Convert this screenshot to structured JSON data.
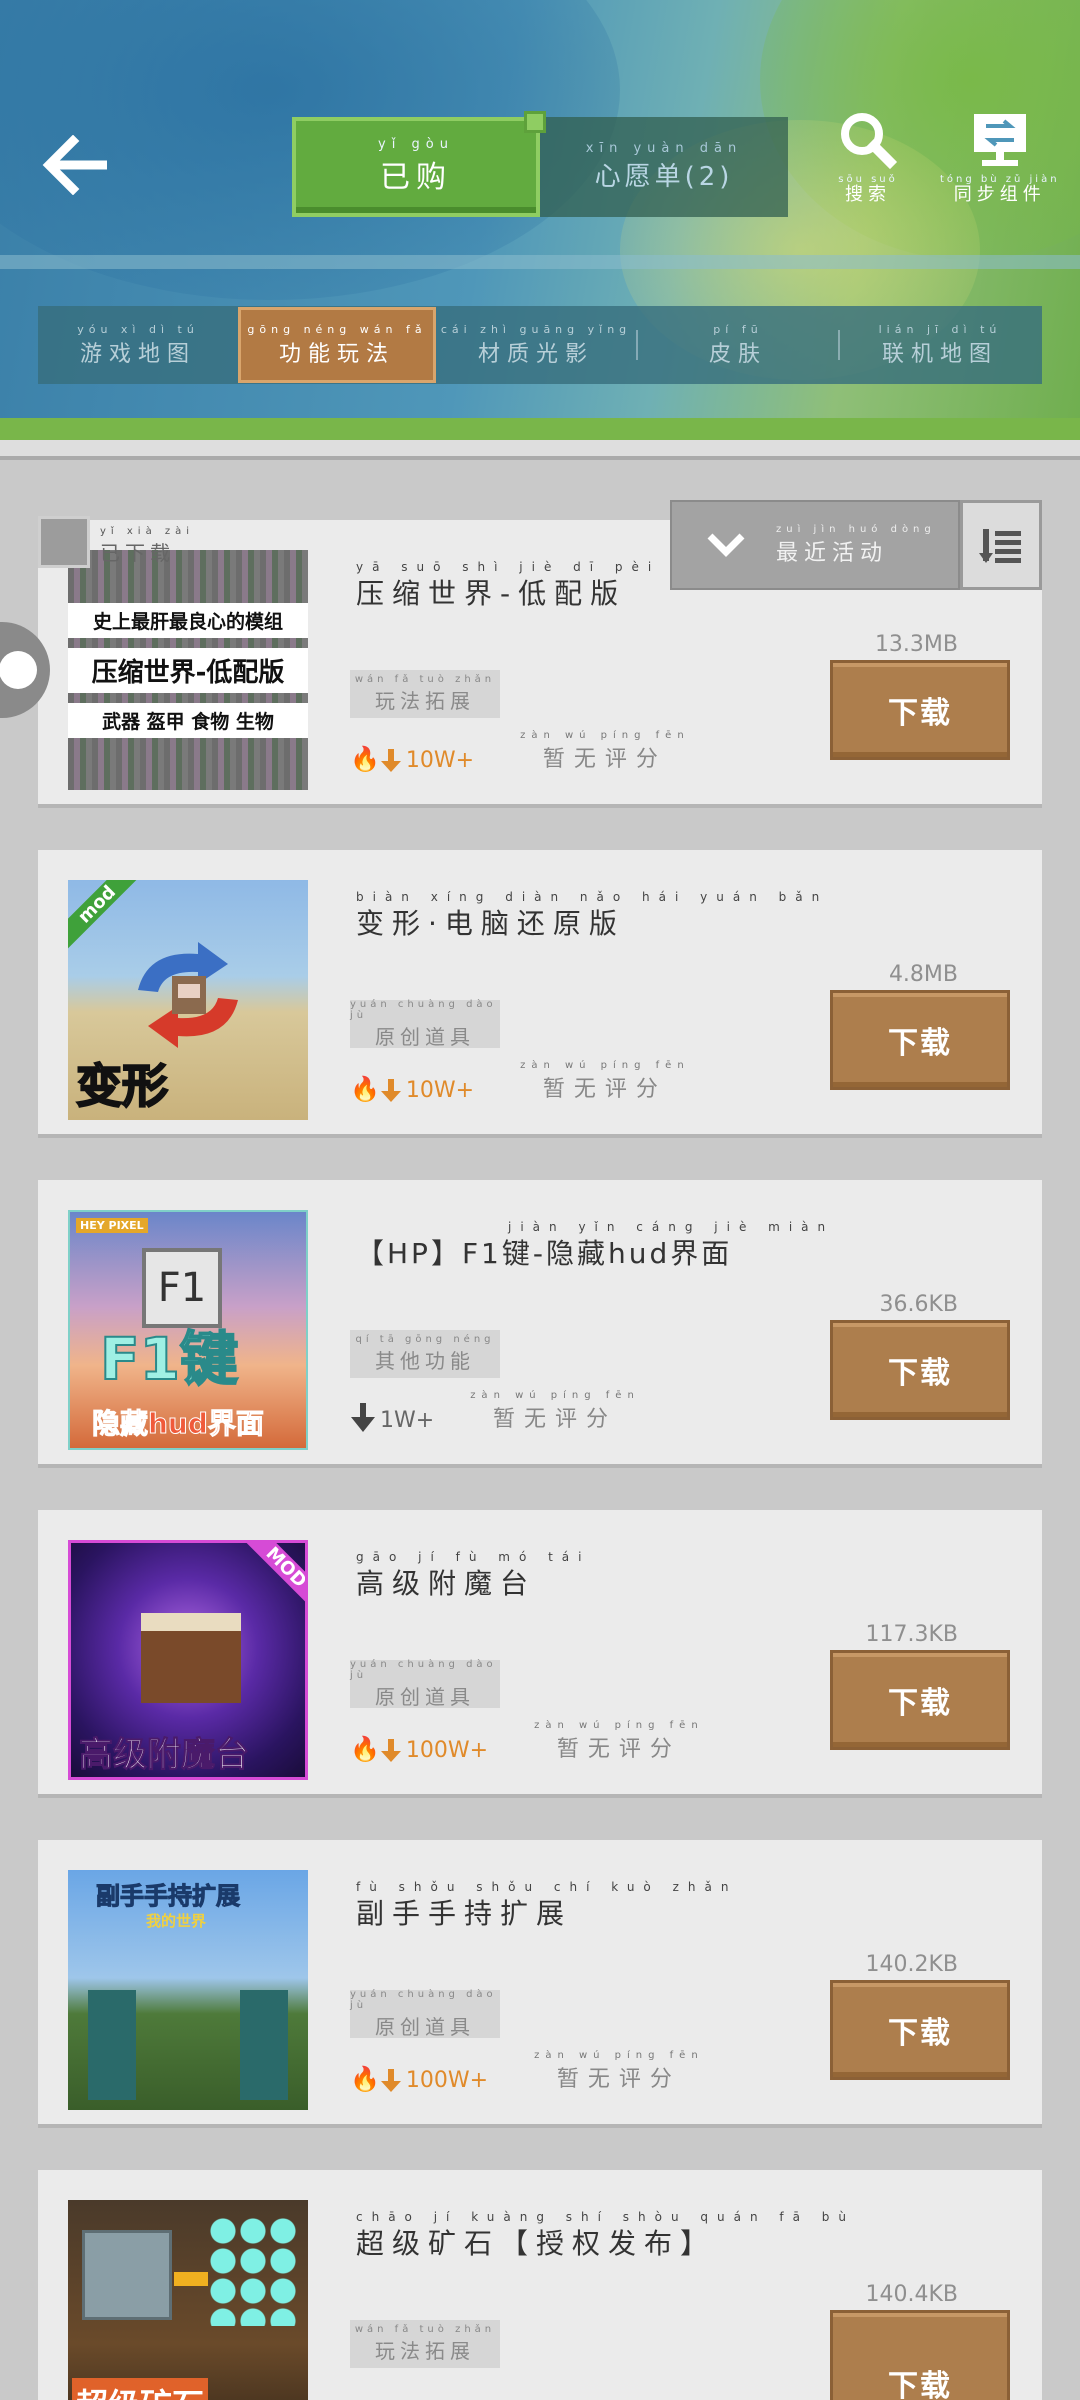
{
  "header": {
    "tabs": [
      {
        "pinyin": "yǐ gòu",
        "label": "已购"
      },
      {
        "pinyin": "xīn yuàn dān",
        "label": "心愿单(2)"
      }
    ],
    "search": {
      "pinyin": "sōu suǒ",
      "label": "搜索"
    },
    "sync": {
      "pinyin": "tóng bù zǔ jiàn",
      "label": "同步组件"
    }
  },
  "categories": [
    {
      "pinyin": "yóu xì dì tú",
      "label": "游戏地图"
    },
    {
      "pinyin": "gōng néng wán fǎ",
      "label": "功能玩法"
    },
    {
      "pinyin": "cái zhì guāng yǐng",
      "label": "材质光影"
    },
    {
      "pinyin": "pí fū",
      "label": "皮肤"
    },
    {
      "pinyin": "lián jī dì tú",
      "label": "联机地图"
    }
  ],
  "filter": {
    "downloaded_pinyin": "yǐ xià zài",
    "downloaded_label": "已下载",
    "sort_pinyin": "zuì jìn huó dòng",
    "sort_label": "最近活动"
  },
  "items": [
    {
      "title_pinyin": "yā suō shì jiè dī pèi bǎn",
      "title": "压缩世界-低配版",
      "tag_pinyin": "wán fǎ tuò zhǎn",
      "tag": "玩法拓展",
      "downloads": "10W+",
      "hot": true,
      "rating_pinyin": "zàn wú píng fēn",
      "rating": "暂无评分",
      "size": "13.3MB",
      "button": "下载",
      "thumb_lines": [
        "史上最肝最良心的模组",
        "压缩世界-低配版",
        "武器 盔甲 食物 生物"
      ]
    },
    {
      "title_pinyin": "biàn xíng diàn nǎo hái yuán bǎn",
      "title": "变形·电脑还原版",
      "tag_pinyin": "yuán chuàng dào jù",
      "tag": "原创道具",
      "downloads": "10W+",
      "hot": true,
      "rating_pinyin": "zàn wú píng fēn",
      "rating": "暂无评分",
      "size": "4.8MB",
      "button": "下载",
      "thumb_text": "变形",
      "thumb_badge": "mod"
    },
    {
      "title_pinyin": "jiàn yǐn cáng jiè miàn",
      "title": "【HP】F1键-隐藏hud界面",
      "tag_pinyin": "qí tā gōng néng",
      "tag": "其他功能",
      "downloads": "1W+",
      "hot": false,
      "rating_pinyin": "zàn wú píng fēn",
      "rating": "暂无评分",
      "size": "36.6KB",
      "button": "下载",
      "thumb_brand": "HEY PIXEL",
      "thumb_key": "F1",
      "thumb_text": "F1键",
      "thumb_sub": "隐藏hud界面"
    },
    {
      "title_pinyin": "gāo jí fù mó tái",
      "title": "高级附魔台",
      "tag_pinyin": "yuán chuàng dào jù",
      "tag": "原创道具",
      "downloads": "100W+",
      "hot": true,
      "rating_pinyin": "zàn wú píng fēn",
      "rating": "暂无评分",
      "size": "117.3KB",
      "button": "下载",
      "thumb_text": "高级附魔台",
      "thumb_badge": "MOD"
    },
    {
      "title_pinyin": "fù shǒu shǒu chí kuò zhǎn",
      "title": "副手手持扩展",
      "tag_pinyin": "yuán chuàng dào jù",
      "tag": "原创道具",
      "downloads": "100W+",
      "hot": true,
      "rating_pinyin": "zàn wú píng fēn",
      "rating": "暂无评分",
      "size": "140.2KB",
      "button": "下载",
      "thumb_text": "副手手持扩展",
      "thumb_sub": "我的世界"
    },
    {
      "title_pinyin": "chāo jí kuàng shí shòu quán fā bù",
      "title": "超级矿石【授权发布】",
      "tag_pinyin": "wán fǎ tuò zhǎn",
      "tag": "玩法拓展",
      "downloads": "",
      "hot": false,
      "rating_pinyin": "",
      "rating": "",
      "size": "140.4KB",
      "button": "下载",
      "thumb_text": "超级矿石"
    }
  ],
  "colors": {
    "accent_green": "#62ab3f",
    "download_brown": "#ad7e4d",
    "hot_orange": "#e08a2a"
  }
}
